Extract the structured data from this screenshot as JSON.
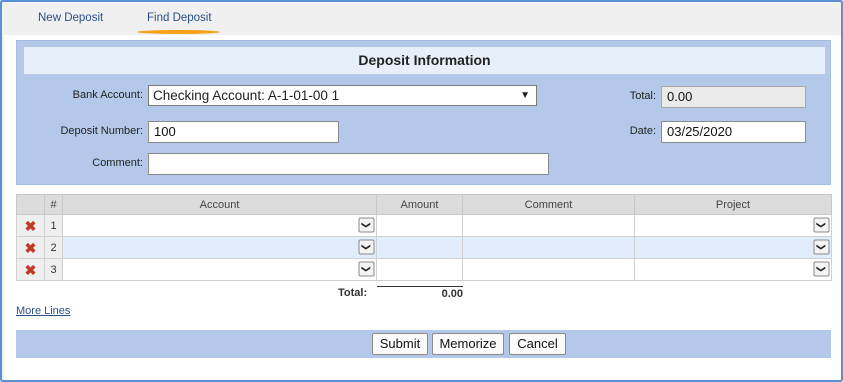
{
  "tabs": {
    "new_deposit": "New Deposit",
    "find_deposit": "Find Deposit"
  },
  "info": {
    "title": "Deposit Information",
    "bank_account_label": "Bank Account:",
    "bank_account_value": "Checking Account: A-1-01-00 1",
    "deposit_number_label": "Deposit Number:",
    "deposit_number_value": "100",
    "comment_label": "Comment:",
    "comment_value": "",
    "total_label": "Total:",
    "total_value": "0.00",
    "date_label": "Date:",
    "date_value": "03/25/2020"
  },
  "grid": {
    "columns": [
      "#",
      "Account",
      "Amount",
      "Comment",
      "Project"
    ],
    "rows": [
      {
        "num": "1",
        "account": "",
        "amount": "",
        "comment": "",
        "project": ""
      },
      {
        "num": "2",
        "account": "",
        "amount": "",
        "comment": "",
        "project": ""
      },
      {
        "num": "3",
        "account": "",
        "amount": "",
        "comment": "",
        "project": ""
      }
    ],
    "totals_label": "Total:",
    "totals_value": "0.00",
    "delete_icon": "x",
    "dropdown_icon": "chevron-down-icon"
  },
  "more_lines": "More Lines",
  "actions": {
    "submit": "Submit",
    "memorize": "Memorize",
    "cancel": "Cancel"
  },
  "colors": {
    "accent_tab_underline": "#f3a21a",
    "panel_blue": "#b4c9ea",
    "frame_border": "#5b8fd6",
    "delete_red": "#c0392b"
  }
}
